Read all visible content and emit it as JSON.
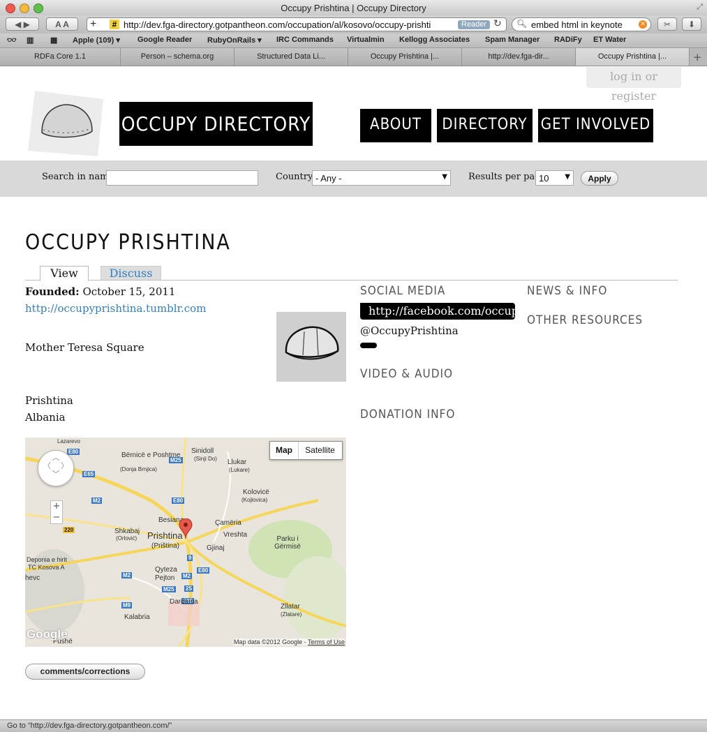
{
  "browser": {
    "window_title": "Occupy Prishtina | Occupy Directory",
    "url": "http://dev.fga-directory.gotpantheon.com/occupation/al/kosovo/occupy-prishti",
    "reader_label": "Reader",
    "search_value": "embed html in keynote",
    "bookmarks": [
      "Apple (109) ▾",
      "Google Reader",
      "RubyOnRails ▾",
      "IRC Commands",
      "Virtualmin",
      "Kellogg Associates",
      "Spam Manager",
      "RADiFy",
      "ET Water"
    ],
    "tabs": [
      "RDFa Core 1.1",
      "Person – schema.org",
      "Structured Data Li...",
      "Occupy Prishtina |...",
      "http://dev.fga-dir...",
      "Occupy Prishtina |..."
    ],
    "active_tab_index": 5,
    "status_text": "Go to “http://dev.fga-directory.gotpantheon.com/”"
  },
  "header": {
    "login_label": "log in or register",
    "brand": "OCCUPY DIRECTORY",
    "nav": [
      "ABOUT",
      "DIRECTORY",
      "GET INVOLVED"
    ]
  },
  "filters": {
    "search_label": "Search in name",
    "search_value": "",
    "country_label": "Country",
    "country_value": "- Any -",
    "results_label": "Results per page",
    "results_value": "10",
    "apply_label": "Apply"
  },
  "page": {
    "title": "OCCUPY PRISHTINA",
    "tabs": [
      "View",
      "Discuss"
    ],
    "founded_label": "Founded:",
    "founded_value": "October 15, 2011",
    "website": "http://occupyprishtina.tumblr.com",
    "location": "Mother Teresa Square",
    "city": "Prishtina",
    "country": "Albania",
    "comments_button": "comments/corrections"
  },
  "sidebar": {
    "social_media_heading": "SOCIAL MEDIA",
    "facebook": "http://facebook.com/occupyprishtina",
    "twitter": "@OccupyPrishtina",
    "video_heading": "VIDEO & AUDIO",
    "donation_heading": "DONATION INFO",
    "news_heading": "NEWS & INFO",
    "other_heading": "OTHER RESOURCES"
  },
  "map": {
    "map_button": "Map",
    "satellite_button": "Satellite",
    "attribution": "Map data ©2012 Google -",
    "terms": "Terms of Use",
    "google_logo": "Google",
    "labels": [
      "Lazarevo",
      "Bërnicë e Poshtme",
      "(Donja Brnjica)",
      "Sinidoll",
      "(Sinji Do)",
      "Llukar",
      "(Lukare)",
      "Kolovicë",
      "(Kojlovica)",
      "Besiana",
      "Prishtina",
      "(Priština)",
      "Çamëria",
      "Vreshta",
      "Gjinaj",
      "Shkabaj",
      "(Orlović)",
      "Parku i Gërmisë",
      "Deponia e hirit",
      "TC Kosova A",
      "hevc",
      "Qyteza",
      "Pejton",
      "Dardania",
      "Kalabria",
      "Zllatar",
      "(Zlatare)",
      "Fushë"
    ],
    "shields": [
      "E80",
      "E65",
      "M25",
      "E80",
      "M2",
      "220",
      "9",
      "E80",
      "M2",
      "M25",
      "25",
      "M9",
      "M2",
      "E65"
    ]
  }
}
